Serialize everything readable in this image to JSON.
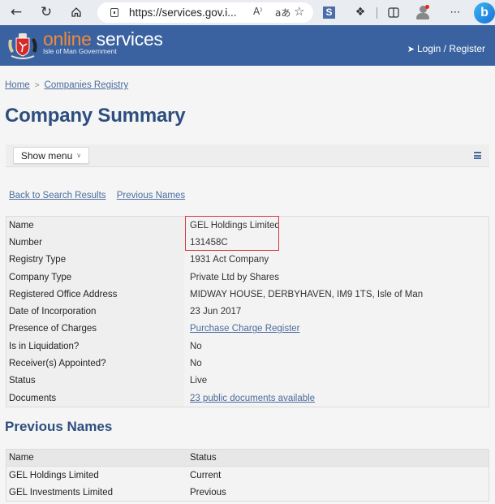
{
  "browser": {
    "url": "https://services.gov.i...",
    "read_aloud_icon": "A⁾",
    "translate_icon": "aあ"
  },
  "header": {
    "brand_online": "online",
    "brand_services": " services",
    "brand_subtitle": "Isle of Man Government",
    "login_label": "Login / Register"
  },
  "breadcrumb": {
    "items": [
      "Home",
      "Companies Registry"
    ],
    "separator": ">"
  },
  "page_title": "Company Summary",
  "menu": {
    "show_menu_label": "Show menu",
    "chevron": "∨"
  },
  "links": {
    "back": "Back to Search Results",
    "previous_names": "Previous Names"
  },
  "summary": {
    "rows": [
      {
        "label": "Name",
        "value": "GEL Holdings Limited"
      },
      {
        "label": "Number",
        "value": "131458C"
      },
      {
        "label": "Registry Type",
        "value": "1931 Act Company"
      },
      {
        "label": "Company Type",
        "value": "Private Ltd by Shares"
      },
      {
        "label": "Registered Office Address",
        "value": "MIDWAY HOUSE, DERBYHAVEN, IM9 1TS, Isle of Man"
      },
      {
        "label": "Date of Incorporation",
        "value": "23 Jun 2017"
      },
      {
        "label": "Presence of Charges",
        "value": "Purchase Charge Register"
      },
      {
        "label": "Is in Liquidation?",
        "value": "No"
      },
      {
        "label": "Receiver(s) Appointed?",
        "value": "No"
      },
      {
        "label": "Status",
        "value": "Live"
      },
      {
        "label": "Documents",
        "value": "23 public documents available"
      }
    ]
  },
  "previous_names": {
    "title": "Previous Names",
    "headers": [
      "Name",
      "Status"
    ],
    "rows": [
      {
        "name": "GEL Holdings Limited",
        "status": "Current"
      },
      {
        "name": "GEL Investments Limited",
        "status": "Previous"
      }
    ]
  },
  "colors": {
    "header_bg": "#3a62a0",
    "brand_accent": "#f08a3c",
    "title": "#2d4e7e",
    "link": "#4a6c9c",
    "highlight": "#d9363e"
  }
}
